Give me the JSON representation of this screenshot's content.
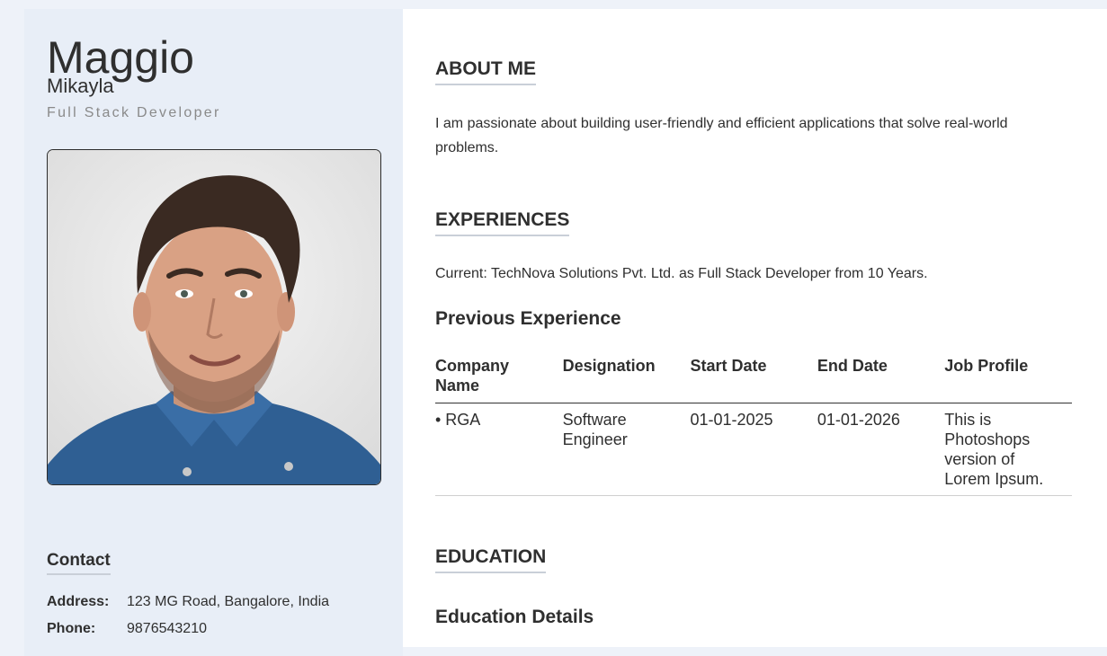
{
  "profile": {
    "last_name": "Maggio",
    "first_name": "Mikayla",
    "job_title": "Full Stack Developer"
  },
  "contact": {
    "heading": "Contact",
    "address_label": "Address:",
    "address_value": "123 MG Road, Bangalore, India",
    "phone_label": "Phone:",
    "phone_value": "9876543210"
  },
  "about": {
    "heading": "ABOUT ME",
    "text": "I am passionate about building user-friendly and efficient applications that solve real-world problems."
  },
  "experiences": {
    "heading": "EXPERIENCES",
    "current": "Current: TechNova Solutions Pvt. Ltd. as Full Stack Developer from 10 Years.",
    "previous_heading": "Previous Experience",
    "columns": [
      "Company Name",
      "Designation",
      "Start Date",
      "End Date",
      "Job Profile"
    ],
    "rows": [
      [
        "• RGA",
        "Software Engineer",
        "01-01-2025",
        "01-01-2026",
        "This is Photoshops version of Lorem Ipsum."
      ]
    ]
  },
  "education": {
    "heading": "EDUCATION",
    "details_heading": "Education Details"
  },
  "colors": {
    "page_bg": "#eef2f9",
    "sidebar_bg": "#e8eef7",
    "main_bg": "#ffffff",
    "text": "#2f2f2f",
    "muted": "#8a8a8a",
    "underline": "#c9cfd8"
  }
}
